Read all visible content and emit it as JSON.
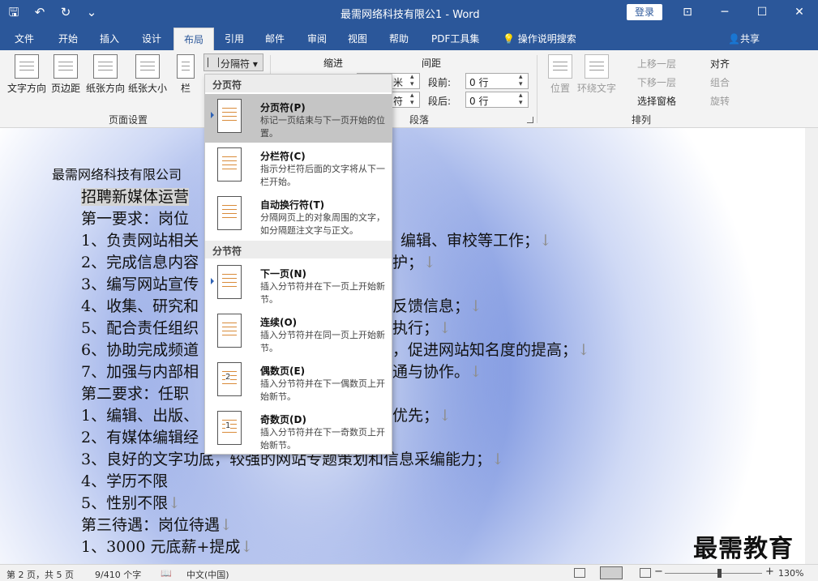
{
  "title_bar": {
    "doc_title": "最需网络科技有限公1 - Word",
    "login": "登录"
  },
  "tabs": [
    "文件",
    "开始",
    "插入",
    "设计",
    "布局",
    "引用",
    "邮件",
    "审阅",
    "视图",
    "帮助",
    "PDF工具集"
  ],
  "active_tab": "布局",
  "tell_me": "操作说明搜索",
  "share": "共享",
  "ribbon": {
    "page_setup": {
      "buttons": [
        "文字方向",
        "页边距",
        "纸张方向",
        "纸张大小",
        "栏"
      ],
      "label": "页面设置"
    },
    "breaks_button": "分隔符",
    "paragraph": {
      "indent_label": "缩进",
      "spacing_label": "间距",
      "indent_left_value": "米",
      "indent_right_value": "符",
      "before_label": "段前:",
      "before_value": "0 行",
      "after_label": "段后:",
      "after_value": "0 行",
      "label": "段落"
    },
    "arrange": {
      "position": "位置",
      "wrap_text": "环绕文字",
      "bring_forward": "上移一层",
      "send_backward": "下移一层",
      "selection_pane": "选择窗格",
      "align": "对齐",
      "group": "组合",
      "rotate": "旋转",
      "label": "排列"
    }
  },
  "breaks_menu": {
    "page_breaks_header": "分页符",
    "section_breaks_header": "分节符",
    "items": [
      {
        "title": "分页符(P)",
        "desc": "标记一页结束与下一页开始的位置。"
      },
      {
        "title": "分栏符(C)",
        "desc": "指示分栏符后面的文字将从下一栏开始。"
      },
      {
        "title": "自动换行符(T)",
        "desc": "分隔网页上的对象周围的文字，如分隔题注文字与正文。"
      },
      {
        "title": "下一页(N)",
        "desc": "插入分节符并在下一页上开始新节。"
      },
      {
        "title": "连续(O)",
        "desc": "插入分节符并在同一页上开始新节。"
      },
      {
        "title": "偶数页(E)",
        "desc": "插入分节符并在下一偶数页上开始新节。",
        "icon_num": "2"
      },
      {
        "title": "奇数页(D)",
        "desc": "插入分节符并在下一奇数页上开始新节。",
        "icon_num": "1"
      }
    ]
  },
  "document_lines": [
    "最需网络科技有限公司",
    "招聘新媒体运营",
    "第一要求：岗位",
    "1、负责网站相关",
    "2、完成信息内容",
    "3、编写网站宣传",
    "4、收集、研究和",
    "5、配合责任组织",
    "6、协助完成频道",
    "7、加强与内部相",
    "第二要求：任职",
    "1、编辑、出版、",
    "2、有媒体编辑经",
    "3、良好的文字功底，较强的网站专题策划和信息采编能力；",
    "4、学历不限",
    "5、性别不限",
    "第三待遇：岗位待遇",
    "1、3000 元底薪+提成"
  ],
  "document_right_fragments": [
    {
      "line": 3,
      "text": "编辑、审校等工作；"
    },
    {
      "line": 4,
      "text": "护；"
    },
    {
      "line": 6,
      "text": "反馈信息；"
    },
    {
      "line": 7,
      "text": "执行；"
    },
    {
      "line": 8,
      "text": "，促进网站知名度的提高；"
    },
    {
      "line": 9,
      "text": "通与协作。"
    },
    {
      "line": 11,
      "text": "优先；"
    }
  ],
  "watermark": "最需教育",
  "status": {
    "page": "第 2 页，共 5 页",
    "words": "9/410 个字",
    "language": "中文(中国)",
    "zoom": "130%"
  }
}
